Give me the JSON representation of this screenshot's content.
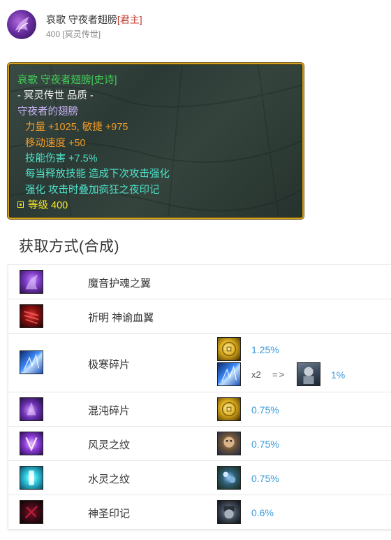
{
  "header": {
    "avatar_icon": "void-wing-icon",
    "item_name": "哀歌 守夜者翅膀",
    "quality_tag": "[君主]",
    "level_text": "400",
    "category_text": "[冥灵传世]"
  },
  "tooltip": {
    "lines": [
      {
        "text": "哀歌 守夜者翅膀[史诗]",
        "color": "green"
      },
      {
        "text": "- 冥灵传世 品质 -",
        "color": "white"
      },
      {
        "text": "守夜者的翅膀",
        "color": "purple"
      },
      {
        "text": "力量 +1025, 敏捷 +975",
        "color": "orange"
      },
      {
        "text": "移动速度 +50",
        "color": "orange"
      },
      {
        "text": "技能伤害 +7.5%",
        "color": "cyan"
      },
      {
        "text": "每当释放技能 造成下次攻击强化",
        "color": "cyan"
      },
      {
        "text": "强化 攻击时叠加疯狂之夜印记",
        "color": "cyan"
      }
    ],
    "level_label": "等级",
    "level_value": "400"
  },
  "section": {
    "title": "获取方式(合成)"
  },
  "recipes": [
    {
      "name": "魔音护魂之翼",
      "icon": "purple-wing-icon"
    },
    {
      "name": "祈明 神谕血翼",
      "icon": "red-wing-icon"
    },
    {
      "name": "极寒碎片",
      "icon": "ice-shard-icon",
      "drops": [
        {
          "icon": "gold-coin-icon",
          "chance": "1.25%"
        },
        {
          "icon": "ice-shard-icon",
          "multiplier": "x2",
          "arrow": "=>",
          "result_icon": "armored-hero-portrait-icon",
          "chance": "1%"
        }
      ]
    },
    {
      "name": "混沌碎片",
      "icon": "chaos-shard-icon",
      "drops": [
        {
          "icon": "gold-coin-icon",
          "chance": "0.75%"
        }
      ]
    },
    {
      "name": "风灵之纹",
      "icon": "wind-rune-icon",
      "drops": [
        {
          "icon": "beast-portrait-icon",
          "chance": "0.75%"
        }
      ]
    },
    {
      "name": "水灵之纹",
      "icon": "water-rune-icon",
      "drops": [
        {
          "icon": "orb-portrait-icon",
          "chance": "0.75%"
        }
      ]
    },
    {
      "name": "神圣印记",
      "icon": "holy-mark-icon",
      "drops": [
        {
          "icon": "orc-portrait-icon",
          "chance": "0.6%"
        }
      ]
    }
  ]
}
